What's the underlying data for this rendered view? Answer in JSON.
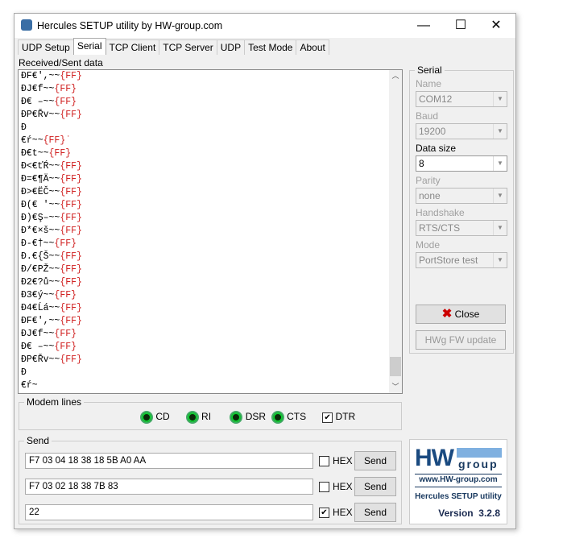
{
  "window": {
    "title": "Hercules SETUP utility by HW-group.com",
    "minimize": "—",
    "maximize": "☐",
    "close": "✕"
  },
  "tabs": [
    {
      "label": "UDP Setup"
    },
    {
      "label": "Serial"
    },
    {
      "label": "TCP Client"
    },
    {
      "label": "TCP Server"
    },
    {
      "label": "UDP"
    },
    {
      "label": "Test Mode"
    },
    {
      "label": "About"
    }
  ],
  "received_label": "Received/Sent data",
  "received_lines": [
    {
      "t": "ÐF€',~~",
      "f": "{FF}"
    },
    {
      "t": "ÐJ€f~~",
      "f": "{FF}"
    },
    {
      "t": "Ð€ –~~",
      "f": "{FF}"
    },
    {
      "t": "ÐP€Řv~~",
      "f": "{FF}"
    },
    {
      "t": "Ð",
      "f": ""
    },
    {
      "t": "€ŕ~~",
      "f": "{FF}˙"
    },
    {
      "t": "Ð€t~~",
      "f": "{FF}"
    },
    {
      "t": "Ð<€ťŔ~~",
      "f": "{FF}"
    },
    {
      "t": "Ð=€¶Ä~~",
      "f": "{FF}"
    },
    {
      "t": "Ð>€ËČ~~",
      "f": "{FF}"
    },
    {
      "t": "Ð(€ '~~",
      "f": "{FF}"
    },
    {
      "t": "Ð)€Ş–~~",
      "f": "{FF}"
    },
    {
      "t": "Ð*€×š~~",
      "f": "{FF}"
    },
    {
      "t": "Ð-€†~~",
      "f": "{FF}"
    },
    {
      "t": "Ð.€{Š~~",
      "f": "{FF}"
    },
    {
      "t": "Ð/€PŽ~~",
      "f": "{FF}"
    },
    {
      "t": "Ð2€?ů~~",
      "f": "{FF}"
    },
    {
      "t": "Ð3€ý~~",
      "f": "{FF}"
    },
    {
      "t": "Ð4€Ĺá~~",
      "f": "{FF}"
    },
    {
      "t": "ÐF€',~~",
      "f": "{FF}"
    },
    {
      "t": "ÐJ€f~~",
      "f": "{FF}"
    },
    {
      "t": "Ð€ –~~",
      "f": "{FF}"
    },
    {
      "t": "ÐP€Řv~~",
      "f": "{FF}"
    },
    {
      "t": "Ð",
      "f": ""
    },
    {
      "t": "€ŕ~",
      "f": ""
    }
  ],
  "serial": {
    "title": "Serial",
    "name_label": "Name",
    "name": "COM12",
    "baud_label": "Baud",
    "baud": "19200",
    "datasize_label": "Data size",
    "datasize": "8",
    "parity_label": "Parity",
    "parity": "none",
    "handshake_label": "Handshake",
    "handshake": "RTS/CTS",
    "mode_label": "Mode",
    "mode": "PortStore test",
    "close_label": "Close",
    "hwg_label": "HWg FW update"
  },
  "modem": {
    "title": "Modem lines",
    "cd": "CD",
    "ri": "RI",
    "dsr": "DSR",
    "cts": "CTS",
    "dtr": "DTR"
  },
  "send": {
    "title": "Send",
    "rows": [
      {
        "value": "F7 03 04 18 38 18 5B A0 AA",
        "hex": false
      },
      {
        "value": "F7 03 02 18 38 7B 83",
        "hex": false
      },
      {
        "value": "22",
        "hex": true
      }
    ],
    "hex_label": "HEX",
    "send_label": "Send"
  },
  "logo": {
    "brand": "HW group",
    "url": "www.HW-group.com",
    "product": "Hercules SETUP utility",
    "version": "Version  3.2.8"
  }
}
